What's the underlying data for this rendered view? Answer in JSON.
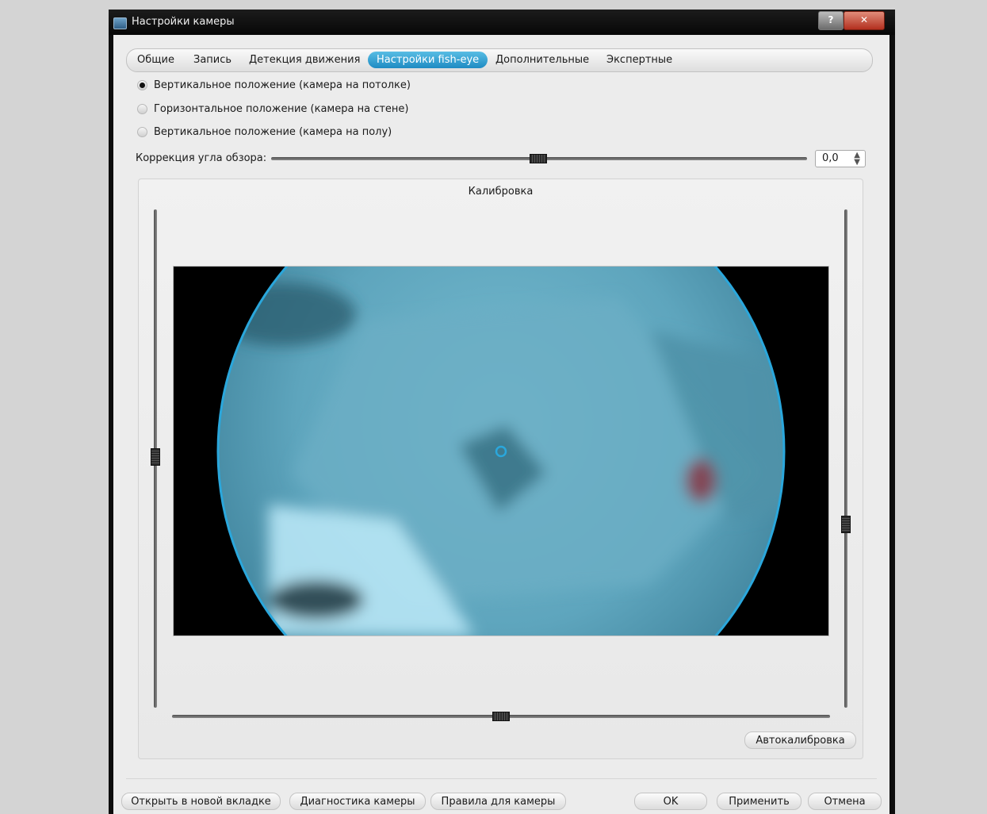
{
  "window": {
    "title": "Настройки камеры",
    "help_label": "?",
    "close_label": "✕"
  },
  "tabs": [
    {
      "label": "Общие"
    },
    {
      "label": "Запись"
    },
    {
      "label": "Детекция движения"
    },
    {
      "label": "Настройки fish-eye",
      "active": true
    },
    {
      "label": "Дополнительные"
    },
    {
      "label": "Экспертные"
    }
  ],
  "mount": {
    "options": [
      {
        "label": "Вертикальное положение (камера на потолке)",
        "checked": true
      },
      {
        "label": "Горизонтальное положение (камера на стене)",
        "checked": false
      },
      {
        "label": "Вертикальное положение (камера на полу)",
        "checked": false
      }
    ]
  },
  "fov": {
    "label": "Коррекция угла обзора:",
    "value": "0,0",
    "slider_position": 0.5
  },
  "calibration": {
    "title": "Калибровка",
    "left_slider_position": 0.49,
    "right_slider_position": 0.63,
    "bottom_slider_position": 0.5,
    "auto_button": "Автокалибровка",
    "circle_color": "#2aa7dc"
  },
  "footer": {
    "open_new_tab": "Открыть в новой вкладке",
    "diagnostics": "Диагностика камеры",
    "camera_rules": "Правила для камеры",
    "ok": "OK",
    "apply": "Применить",
    "cancel": "Отмена"
  },
  "colors": {
    "tab_active": "#1e8bc3",
    "window_frame": "#0d0d0d",
    "dialog_background": "#ececec"
  }
}
